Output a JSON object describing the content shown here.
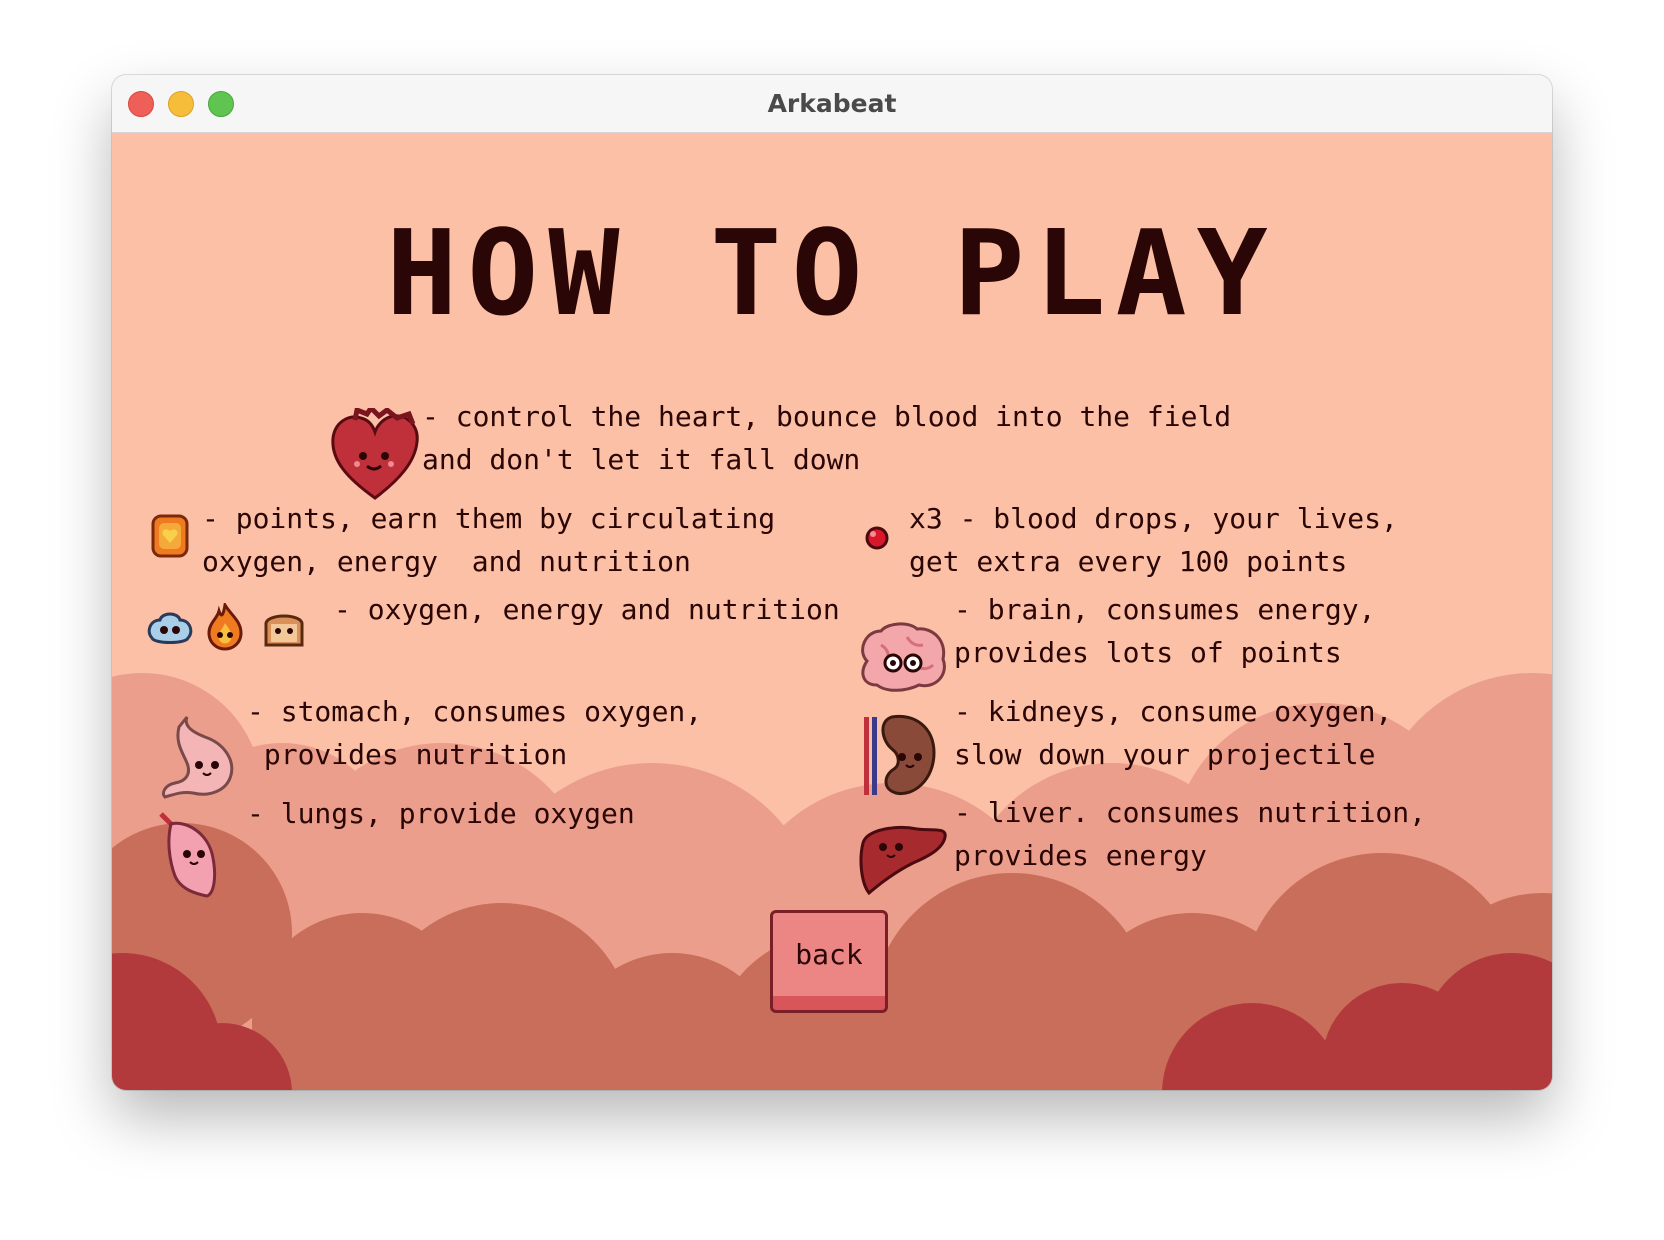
{
  "window": {
    "title": "Arkabeat"
  },
  "screen": {
    "heading": "HOW TO PLAY",
    "heart": {
      "line1": "- control the heart, bounce blood into the field",
      "line2": "and don't let it fall down"
    },
    "points": {
      "line1": "- points, earn them by circulating",
      "line2": "oxygen, energy  and nutrition"
    },
    "resources": {
      "line1": "- oxygen, energy and nutrition"
    },
    "stomach": {
      "line1": "- stomach, consumes oxygen,",
      "line2": " provides nutrition"
    },
    "lungs": {
      "line1": "- lungs, provide oxygen"
    },
    "lives": {
      "line1": "x3 - blood drops, your lives,",
      "line2": "get extra every 100 points"
    },
    "brain": {
      "line1": "- brain, consumes energy,",
      "line2": "provides lots of points"
    },
    "kidneys": {
      "line1": "- kidneys, consume oxygen,",
      "line2": "slow down your projectile"
    },
    "liver": {
      "line1": "- liver. consumes nutrition,",
      "line2": "provides energy"
    },
    "back_label": "back"
  },
  "colors": {
    "background": "#fbc0a5",
    "cloud_light": "#eb9e8b",
    "cloud_mid": "#c96e5b",
    "cloud_dark": "#b33a3c",
    "text": "#2a0606",
    "button": "#ec8684"
  },
  "icons": {
    "heart": "heart-icon",
    "points": "points-coin-icon",
    "oxygen": "oxygen-bubble-icon",
    "energy": "energy-flame-icon",
    "nutrition": "nutrition-bread-icon",
    "blood_drop": "blood-drop-icon",
    "brain": "brain-icon",
    "stomach": "stomach-icon",
    "kidneys": "kidney-icon",
    "lungs": "lung-icon",
    "liver": "liver-icon"
  }
}
